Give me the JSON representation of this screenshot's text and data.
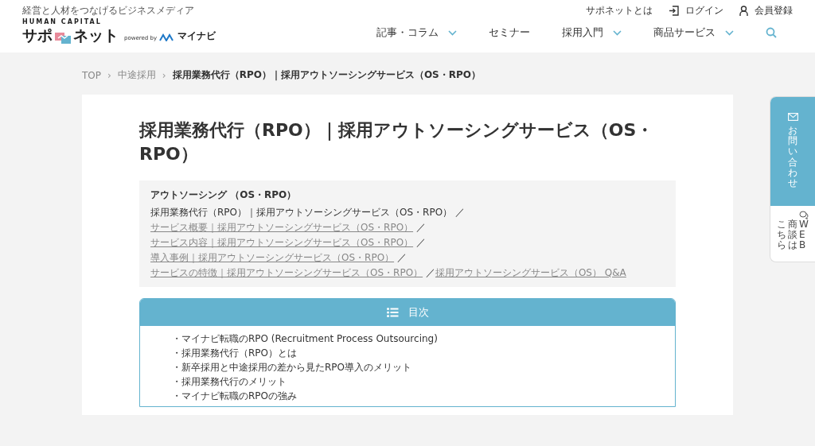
{
  "header": {
    "tagline": "経営と人材をつなげるビジネスメディア",
    "logo": {
      "top": "HUMAN CAPITAL",
      "left": "サポ",
      "right": "ネット",
      "powered": "powered by",
      "partner": "マイナビ"
    },
    "top_links": [
      {
        "label": "サポネットとは",
        "kind": "plain"
      },
      {
        "label": "ログイン",
        "kind": "login"
      },
      {
        "label": "会員登録",
        "kind": "user"
      }
    ],
    "nav": [
      {
        "label": "記事・コラム",
        "dropdown": true
      },
      {
        "label": "セミナー",
        "dropdown": false
      },
      {
        "label": "採用入門",
        "dropdown": true
      },
      {
        "label": "商品サービス",
        "dropdown": true
      }
    ]
  },
  "breadcrumb": [
    {
      "label": "TOP",
      "current": false,
      "separator": "›"
    },
    {
      "label": "中途採用",
      "current": false,
      "separator": "›"
    },
    {
      "label": "採用業務代行（RPO）｜採用アウトソーシングサービス（OS・RPO）",
      "current": true
    }
  ],
  "title": "採用業務代行（RPO）｜採用アウトソーシングサービス（OS・RPO）",
  "related": {
    "heading": "アウトソーシング （OS・RPO）",
    "items": [
      {
        "text": "採用業務代行（RPO）｜採用アウトソーシングサービス（OS・RPO）",
        "link": false,
        "separator": "／"
      },
      {
        "text": "サービス概要｜採用アウトソーシングサービス（OS・RPO）",
        "link": true,
        "separator": "／"
      },
      {
        "text": "サービス内容｜採用アウトソーシングサービス（OS・RPO）",
        "link": true,
        "separator": "／"
      },
      {
        "text": "導入事例｜採用アウトソーシングサービス（OS・RPO）",
        "link": true,
        "separator": "／"
      },
      {
        "text": "サービスの特徴｜採用アウトソーシングサービス（OS・RPO）",
        "link": true,
        "separator": "／"
      },
      {
        "text": "採用アウトソーシングサービス（OS） Q&A",
        "link": true
      }
    ]
  },
  "toc": {
    "title": "目次",
    "items": [
      "・マイナビ転職のRPO (Recruitment Process Outsourcing)",
      "・採用業務代行（RPO）とは",
      "・新卒採用と中途採用の差から見たRPO導入のメリット",
      "・採用業務代行のメリット",
      "・マイナビ転職のRPOの強み"
    ]
  },
  "side_tab": {
    "contact": "お問い合わせ",
    "web_columns": [
      "こちら",
      "商談は",
      "WEB"
    ]
  }
}
